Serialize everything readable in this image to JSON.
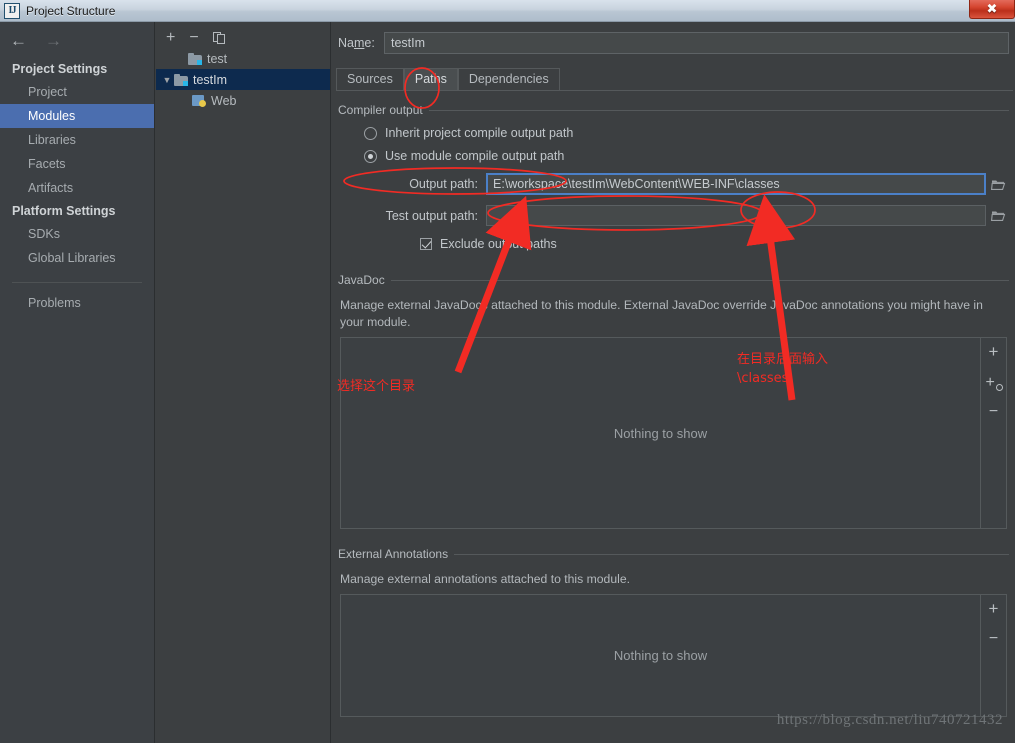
{
  "window": {
    "title": "Project Structure",
    "app_icon": "IJ",
    "close_label": "✖"
  },
  "sidebar": {
    "nav": {
      "back_icon": "←",
      "forward_icon": "→"
    },
    "sections": [
      {
        "heading": "Project Settings",
        "items": [
          {
            "label": "Project",
            "selected": false
          },
          {
            "label": "Modules",
            "selected": true
          },
          {
            "label": "Libraries",
            "selected": false
          },
          {
            "label": "Facets",
            "selected": false
          },
          {
            "label": "Artifacts",
            "selected": false
          }
        ]
      },
      {
        "heading": "Platform Settings",
        "items": [
          {
            "label": "SDKs",
            "selected": false
          },
          {
            "label": "Global Libraries",
            "selected": false
          }
        ]
      }
    ],
    "problems": {
      "label": "Problems"
    }
  },
  "tree": {
    "toolbar": {
      "add": "+",
      "remove": "−",
      "copy": "copy-icon"
    },
    "rows": [
      {
        "label": "test",
        "icon": "module-folder-icon",
        "indent": 1,
        "twisty": "",
        "selected": false
      },
      {
        "label": "testIm",
        "icon": "module-folder-icon",
        "indent": 0,
        "twisty": "▼",
        "selected": true
      },
      {
        "label": "Web",
        "icon": "web-facet-icon",
        "indent": 2,
        "twisty": "",
        "selected": false
      }
    ]
  },
  "main": {
    "name_field": {
      "label_pre": "Na",
      "label_mnemonic": "m",
      "label_post": "e:",
      "value": "testIm"
    },
    "tabs": [
      {
        "label": "Sources",
        "active": false
      },
      {
        "label": "Paths",
        "active": true
      },
      {
        "label": "Dependencies",
        "active": false
      }
    ],
    "compiler_output": {
      "group_title": "Compiler output",
      "radio_inherit": {
        "label": "Inherit project compile output path",
        "selected": false
      },
      "radio_module": {
        "label": "Use module compile output path",
        "selected": true
      },
      "output_path": {
        "label": "Output path:",
        "value": "E:\\workspace\\testIm\\WebContent\\WEB-INF\\classes",
        "focused": true
      },
      "test_output_path": {
        "label": "Test output path:",
        "value": "",
        "focused": false
      },
      "exclude_checkbox": {
        "label": "Exclude output paths",
        "checked": true
      }
    },
    "javadoc": {
      "group_title": "JavaDoc",
      "description": "Manage external JavaDocs attached to this module. External JavaDoc override JavaDoc annotations you might have in your module.",
      "empty_text": "Nothing to show",
      "buttons": [
        "+",
        "+globe",
        "−"
      ]
    },
    "external_annotations": {
      "group_title": "External Annotations",
      "description": "Manage external annotations attached to this module.",
      "empty_text": "Nothing to show",
      "buttons": [
        "+",
        "−"
      ]
    },
    "watermark": "https://blog.csdn.net/liu740721432"
  },
  "annotations": {
    "note_select_dir": "选择这个目录",
    "note_append_classes_line1": "在目录后面输入",
    "note_append_classes_line2": "\\classes",
    "color": "#f22b24"
  }
}
